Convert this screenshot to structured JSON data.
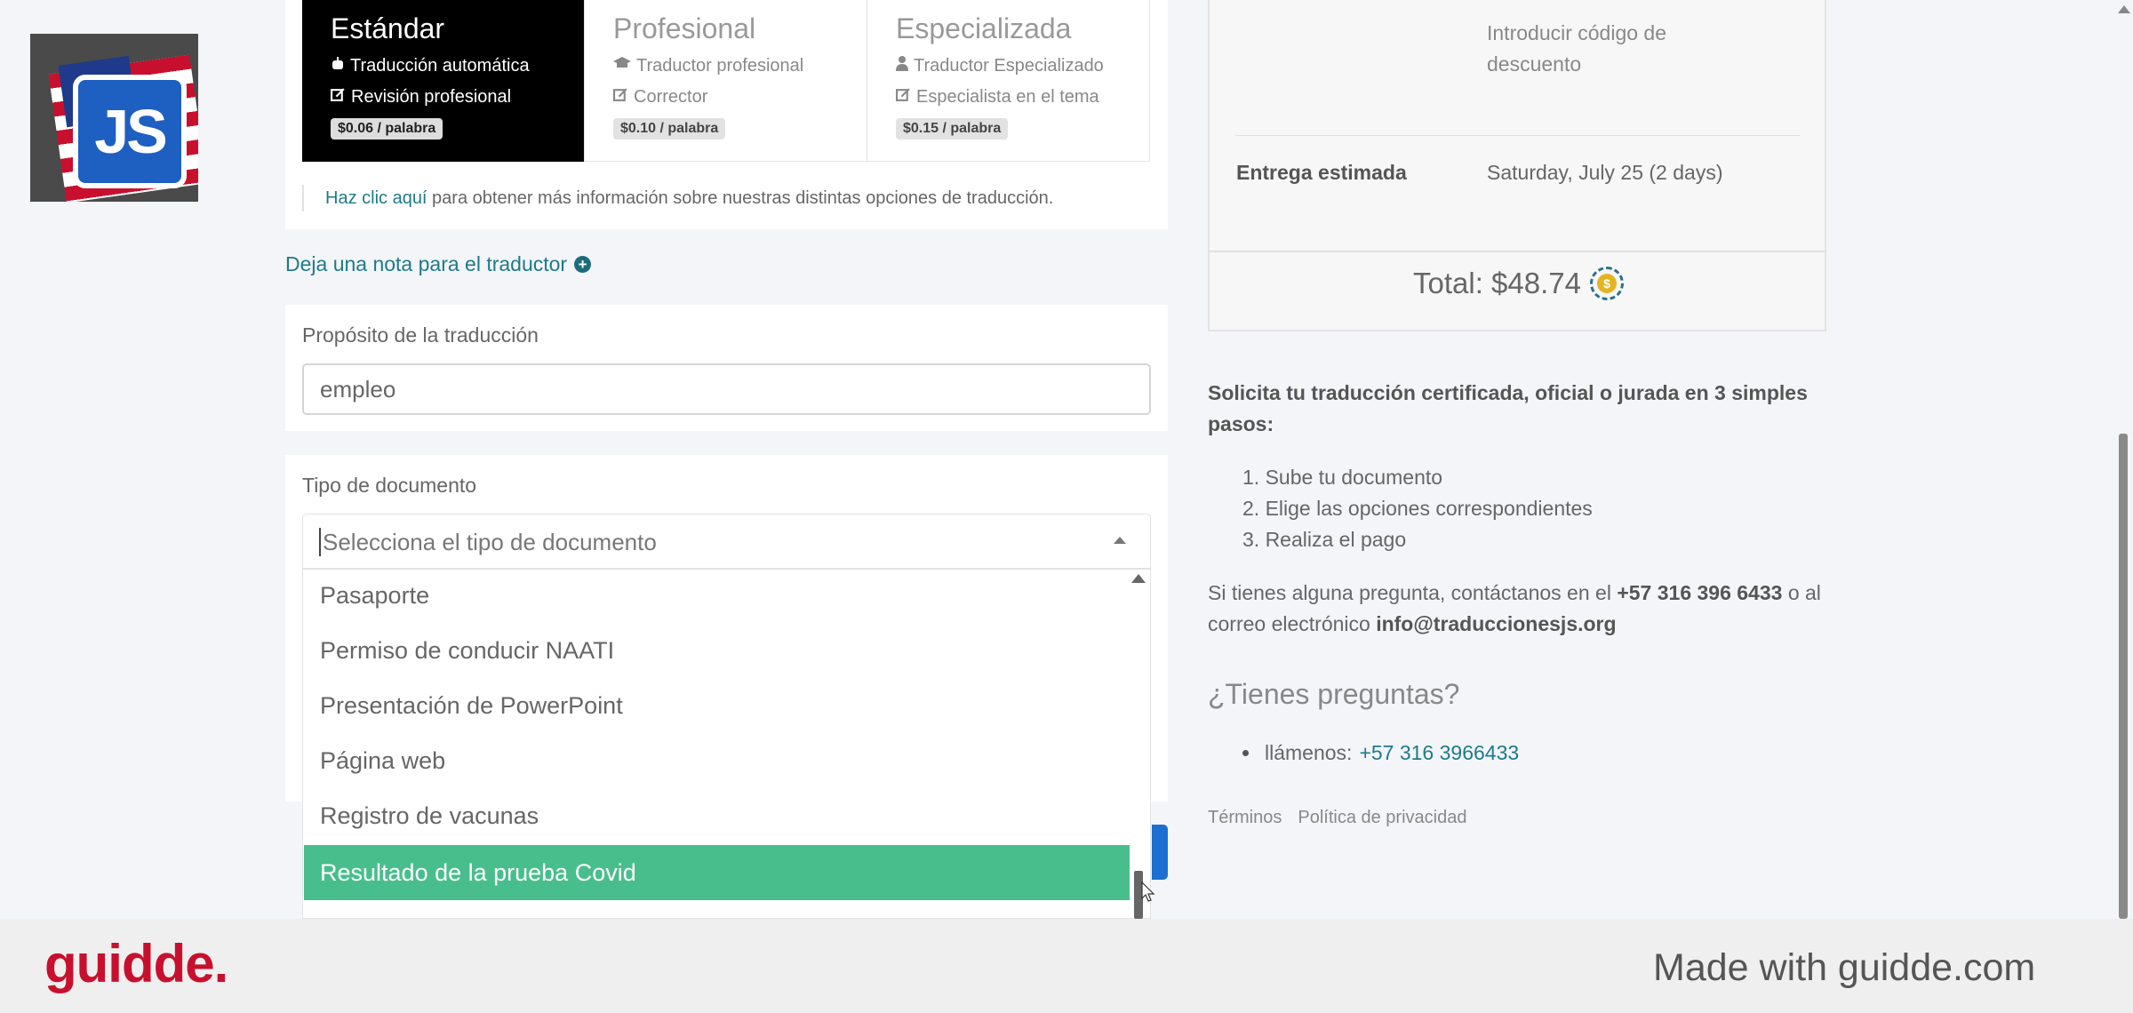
{
  "tiers": [
    {
      "name": "Estándar",
      "features": [
        "Traducción automática",
        "Revisión profesional"
      ],
      "price": "$0.06 / palabra",
      "active": true,
      "icons": [
        "robot-icon",
        "edit-icon"
      ]
    },
    {
      "name": "Profesional",
      "features": [
        "Traductor profesional",
        "Corrector"
      ],
      "price": "$0.10 / palabra",
      "active": false,
      "icons": [
        "graduation-cap-icon",
        "edit-icon"
      ]
    },
    {
      "name": "Especializada",
      "features": [
        "Traductor Especializado",
        "Especialista en el tema"
      ],
      "price": "$0.15 / palabra",
      "active": false,
      "icons": [
        "user-tie-icon",
        "edit-icon"
      ]
    }
  ],
  "info": {
    "link": "Haz clic aquí",
    "rest": " para obtener más información sobre nuestras distintas opciones de traducción."
  },
  "note_link": "Deja una nota para el traductor",
  "purpose": {
    "label": "Propósito de la traducción",
    "value": "empleo"
  },
  "doc_type": {
    "label": "Tipo de documento",
    "placeholder": "Selecciona el tipo de documento",
    "options": [
      "Pasaporte",
      "Permiso de conducir NAATI",
      "Presentación de PowerPoint",
      "Página web",
      "Registro de vacunas",
      "Resultado de la prueba Covid"
    ],
    "highlighted": "Resultado de la prueba Covid"
  },
  "summary": {
    "discount_placeholder": "Introducir código de descuento",
    "delivery_label": "Entrega estimada",
    "delivery_value": "Saturday, July 25 (2 days)",
    "total": "Total: $48.74"
  },
  "steps": {
    "title": "Solicita tu traducción certificada, oficial o jurada en 3 simples pasos:",
    "items": [
      "1. Sube tu documento",
      "2. Elige las opciones correspondientes",
      "3. Realiza el pago"
    ]
  },
  "contact": {
    "pre": "Si tienes alguna pregunta, contáctanos en el ",
    "phone": "+57 316 396 6433",
    "mid": " o al correo electrónico ",
    "email": "info@traduccionesjs.org"
  },
  "faq": {
    "title": "¿Tienes preguntas?",
    "label": "llámenos: ",
    "phone": "+57 316 3966433"
  },
  "footer_links": [
    "Términos",
    "Política de privacidad"
  ],
  "logo_text": "JS",
  "guidde": {
    "logo": "guidde.",
    "made_with": "Made with guidde.com"
  },
  "colors": {
    "highlight": "#48be8c",
    "link": "#1e7a8a",
    "brand_red": "#c8102e"
  }
}
